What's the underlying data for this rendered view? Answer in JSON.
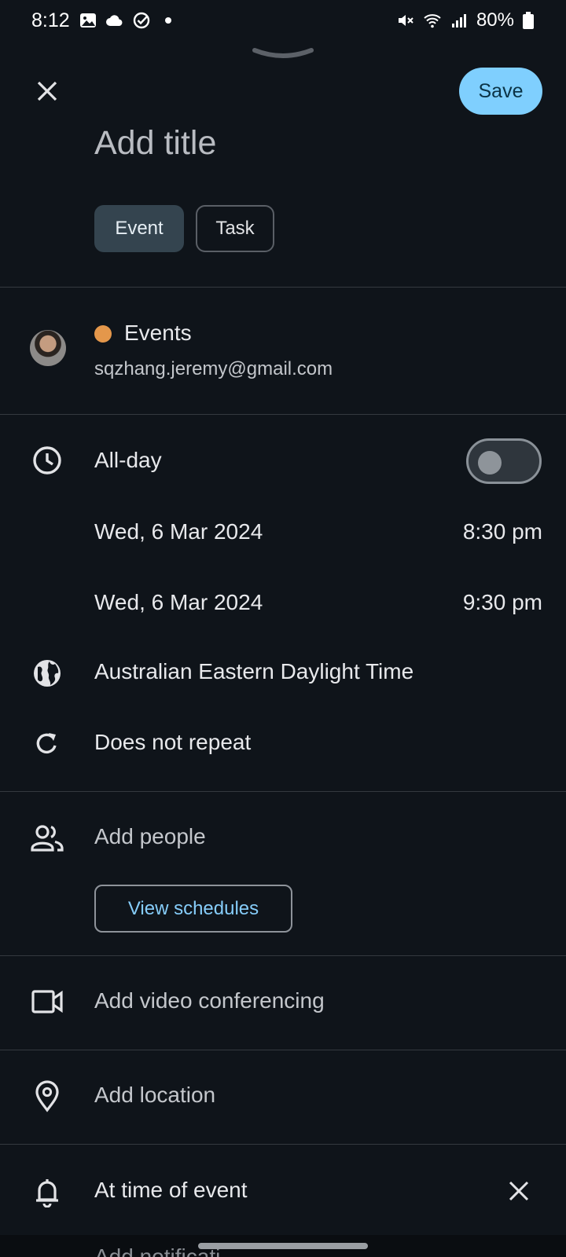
{
  "status_bar": {
    "time": "8:12",
    "battery": "80%",
    "icons": [
      "gallery-icon",
      "cloud-icon",
      "check-circle-icon",
      "dot-icon",
      "mute-icon",
      "wifi-icon",
      "signal-icon",
      "battery-icon"
    ]
  },
  "header": {
    "close_icon": "close-icon",
    "save_label": "Save",
    "title_placeholder": "Add title"
  },
  "type_chips": [
    {
      "label": "Event",
      "selected": true
    },
    {
      "label": "Task",
      "selected": false
    }
  ],
  "calendar": {
    "name": "Events",
    "email": "sqzhang.jeremy@gmail.com",
    "color": "#e4974b"
  },
  "time_section": {
    "all_day_label": "All-day",
    "all_day_on": false,
    "start_date": "Wed, 6 Mar 2024",
    "start_time": "8:30 pm",
    "end_date": "Wed, 6 Mar 2024",
    "end_time": "9:30 pm",
    "timezone": "Australian Eastern Daylight Time",
    "repeat": "Does not repeat"
  },
  "people": {
    "label": "Add people",
    "view_schedules": "View schedules"
  },
  "video": {
    "label": "Add video conferencing"
  },
  "location": {
    "label": "Add location"
  },
  "notification": {
    "label": "At time of event",
    "add_label_partial": "Add notificati"
  },
  "colors": {
    "background": "#0f141a",
    "accent": "#7fcffe",
    "link": "#86cdfa"
  }
}
